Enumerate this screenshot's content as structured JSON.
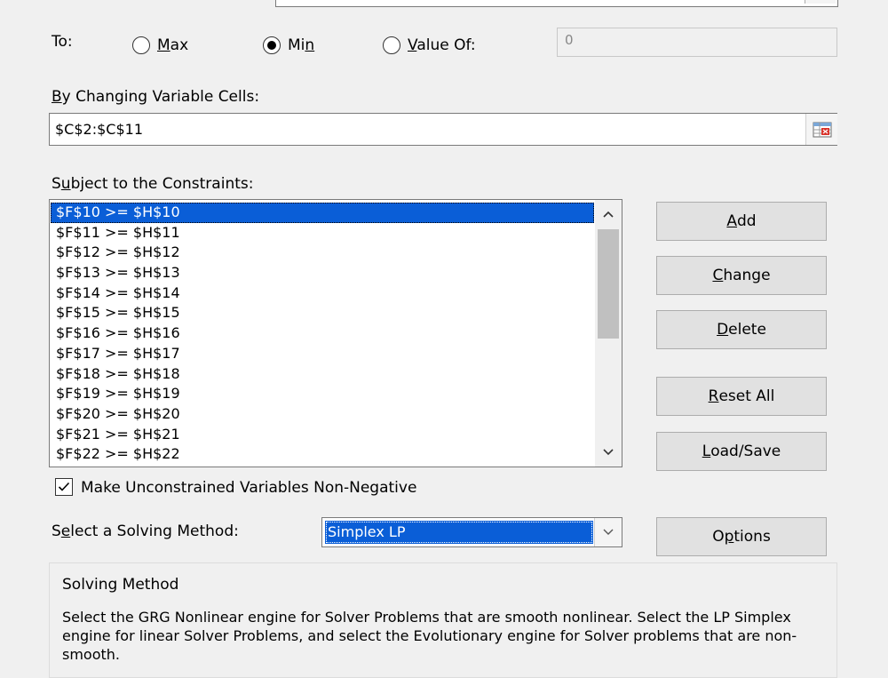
{
  "objective": {
    "to_label": "To:",
    "options": [
      {
        "pre": "",
        "key": "M",
        "post": "ax",
        "selected": false
      },
      {
        "pre": "",
        "key": "",
        "post": "Mi",
        "key2": "n",
        "selected": true
      },
      {
        "pre": "",
        "key": "V",
        "post": "alue Of:",
        "selected": false
      }
    ],
    "value_of": "0"
  },
  "variable_cells": {
    "label_pre": "",
    "label_key": "B",
    "label_post": "y Changing Variable Cells:",
    "value": "$C$2:$C$11"
  },
  "constraints": {
    "label_pre": "S",
    "label_key": "u",
    "label_post": "bject to the Constraints:",
    "items": [
      "$F$10 >= $H$10",
      "$F$11 >= $H$11",
      "$F$12 >= $H$12",
      "$F$13 >= $H$13",
      "$F$14 >= $H$14",
      "$F$15 >= $H$15",
      "$F$16 >= $H$16",
      "$F$17 >= $H$17",
      "$F$18 >= $H$18",
      "$F$19 >= $H$19",
      "$F$20 >= $H$20",
      "$F$21 >= $H$21",
      "$F$22 >= $H$22"
    ],
    "selected_index": 0
  },
  "buttons": {
    "add": {
      "key": "A",
      "rest": "dd"
    },
    "change": {
      "key": "C",
      "rest": "hange"
    },
    "delete": {
      "key": "D",
      "rest": "elete"
    },
    "reset_all": {
      "key": "R",
      "rest": "eset All"
    },
    "load_save": {
      "key": "L",
      "rest": "oad/Save"
    },
    "options": {
      "pre": "O",
      "key": "p",
      "rest": "tions"
    }
  },
  "non_negative": {
    "label": "Make Unconstrained Variables Non-Negative",
    "checked": true
  },
  "solving_method": {
    "label_pre": "S",
    "label_key": "e",
    "label_post": "lect a Solving Method:",
    "selected": "Simplex LP"
  },
  "solving_method_group": {
    "title": "Solving Method",
    "description": "Select the GRG Nonlinear engine for Solver Problems that are smooth nonlinear. Select the LP Simplex engine for linear Solver Problems, and select the Evolutionary engine for Solver problems that are non-smooth."
  }
}
